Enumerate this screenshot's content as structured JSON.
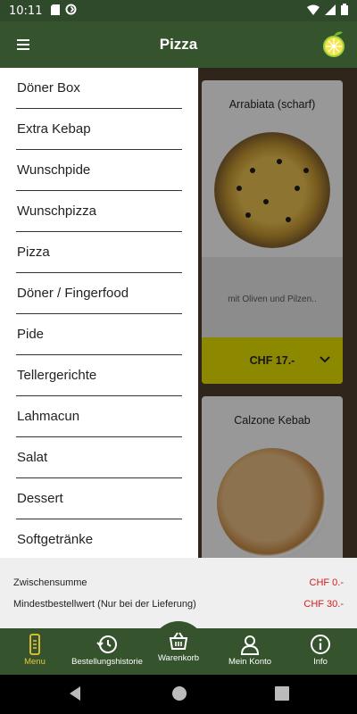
{
  "status_bar": {
    "time": "10:11"
  },
  "app_bar": {
    "title": "Pizza"
  },
  "drawer": {
    "items": [
      {
        "label": "Döner Box"
      },
      {
        "label": "Extra Kebap"
      },
      {
        "label": "Wunschpide"
      },
      {
        "label": "Wunschpizza"
      },
      {
        "label": "Pizza"
      },
      {
        "label": "Döner / Fingerfood"
      },
      {
        "label": "Pide"
      },
      {
        "label": "Tellergerichte"
      },
      {
        "label": "Lahmacun"
      },
      {
        "label": "Salat"
      },
      {
        "label": "Dessert"
      },
      {
        "label": "Softgetränke"
      }
    ]
  },
  "products": [
    {
      "title": "Arrabiata (scharf)",
      "description": "mit Oliven und Pilzen..",
      "price": "CHF 17.-"
    },
    {
      "title": "Calzone Kebab"
    }
  ],
  "summary": {
    "subtotal_label": "Zwischensumme",
    "subtotal_value": "CHF 0.-",
    "minimum_label": "Mindestbestellwert (Nur bei der Lieferung)",
    "minimum_value": "CHF 30.-"
  },
  "bottom_nav": {
    "menu": "Menu",
    "history": "Bestellungshistorie",
    "cart": "Warenkorb",
    "account": "Mein Konto",
    "info": "Info"
  },
  "colors": {
    "primary_green": "#35542e",
    "accent_yellow": "#d7d300",
    "active_label": "#e8c53a",
    "price_red": "#d11d1d"
  },
  "icons": [
    "hamburger-menu-icon",
    "lime-logo-icon",
    "chevron-down-icon",
    "phone-menu-icon",
    "history-icon",
    "basket-icon",
    "person-icon",
    "info-icon",
    "back-icon",
    "home-icon",
    "recents-icon"
  ]
}
